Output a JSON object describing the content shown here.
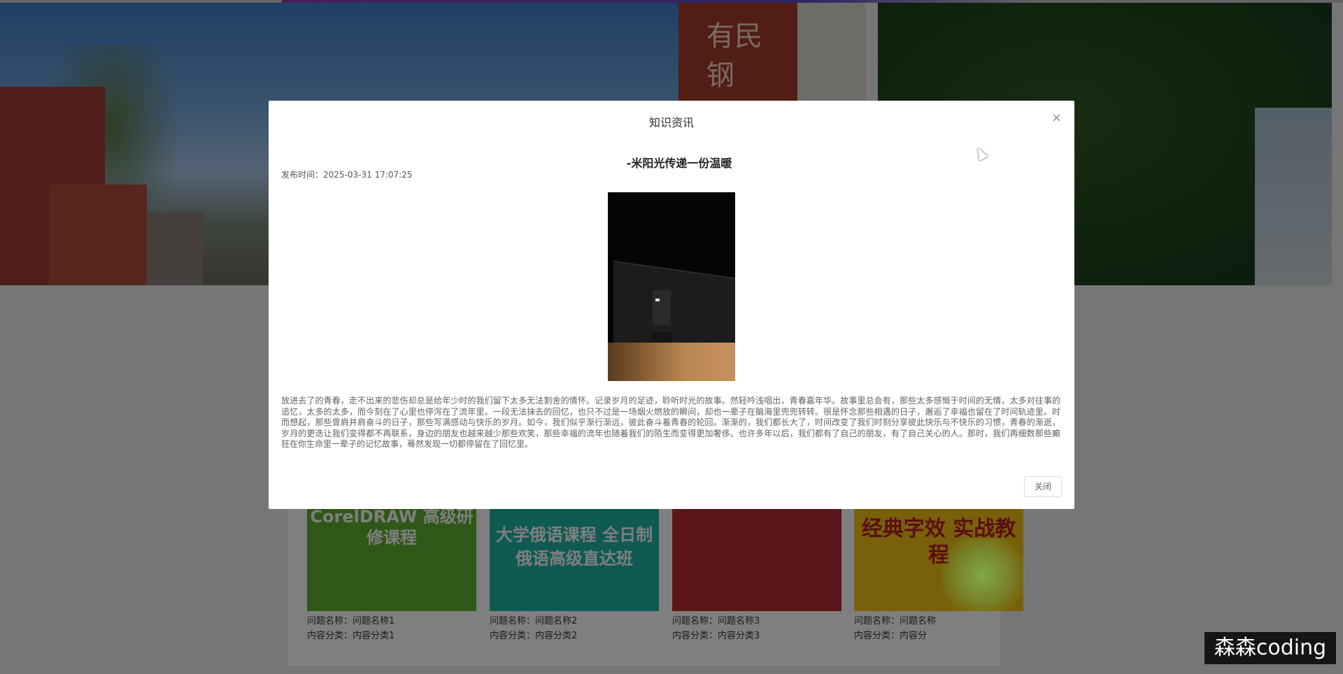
{
  "modal": {
    "title": "知识资讯",
    "close_icon": "×",
    "article_title": "-米阳光传递一份温暖",
    "publish_label": "发布时间：",
    "publish_time": "2025-03-31 17:07:25",
    "body": "放进去了的青春，走不出来的悲伤却总是给年少时的我们留下太多无法割舍的情怀。记录岁月的足迹，聆听时光的故事。然轻吟浅唱出，青春嘉年华。故事里总会有，那些太多感慨于时间的无情，太多对往事的追忆，太多的太多，而今刻在了心里也停泻在了流年里。一段无法抹去的回忆，也只不过是一场烟火燃放的瞬间，却也一辈子在脑海里兜兜转转。很是怀念那些相遇的日子，邂逅了幸福也留在了时间轨迹里。时而想起，那些曾肩并肩奋斗的日子，那些写满感动与快乐的岁月。如今，我们似乎渐行渐远，彼此奋斗着青春的轮回。渐渐的，我们都长大了，时间改变了我们时刻分享彼此快乐与不快乐的习惯，青春的渐逝，岁月的更迭让我们变得都不再联系，身边的朋友也越来越少那些欢笑，那些幸福的流年也随着我们的陌生而变得更加奢侈。也许多年以后，我们都有了自己的朋友，有了自己关心的人。那时，我们再细数那些癫狂在你生命里一辈子的记忆故事，蓦然发现一切都停留在了回忆里。",
    "close_button": "关闭"
  },
  "banner": {
    "tower_text": "有民钢"
  },
  "courses": [
    {
      "thumb_text": "CorelDRAW 高级研修课程",
      "name_label": "问题名称：",
      "name": "问题名称1",
      "category_label": "内容分类：",
      "category": "内容分类1"
    },
    {
      "thumb_text": "大学俄语课程 全日制俄语高级直达班",
      "name_label": "问题名称：",
      "name": "问题名称2",
      "category_label": "内容分类：",
      "category": "内容分类2"
    },
    {
      "thumb_text": "",
      "name_label": "问题名称：",
      "name": "问题名称3",
      "category_label": "内容分类：",
      "category": "内容分类3"
    },
    {
      "thumb_text": "经典字效 实战教程",
      "name_label": "问题名称：",
      "name": "问题名称",
      "category_label": "内容分类：",
      "category": "内容分"
    }
  ],
  "watermark": "森森coding",
  "colors": {
    "overlay": "#000000",
    "accent_purple": "#8e3fb0"
  }
}
